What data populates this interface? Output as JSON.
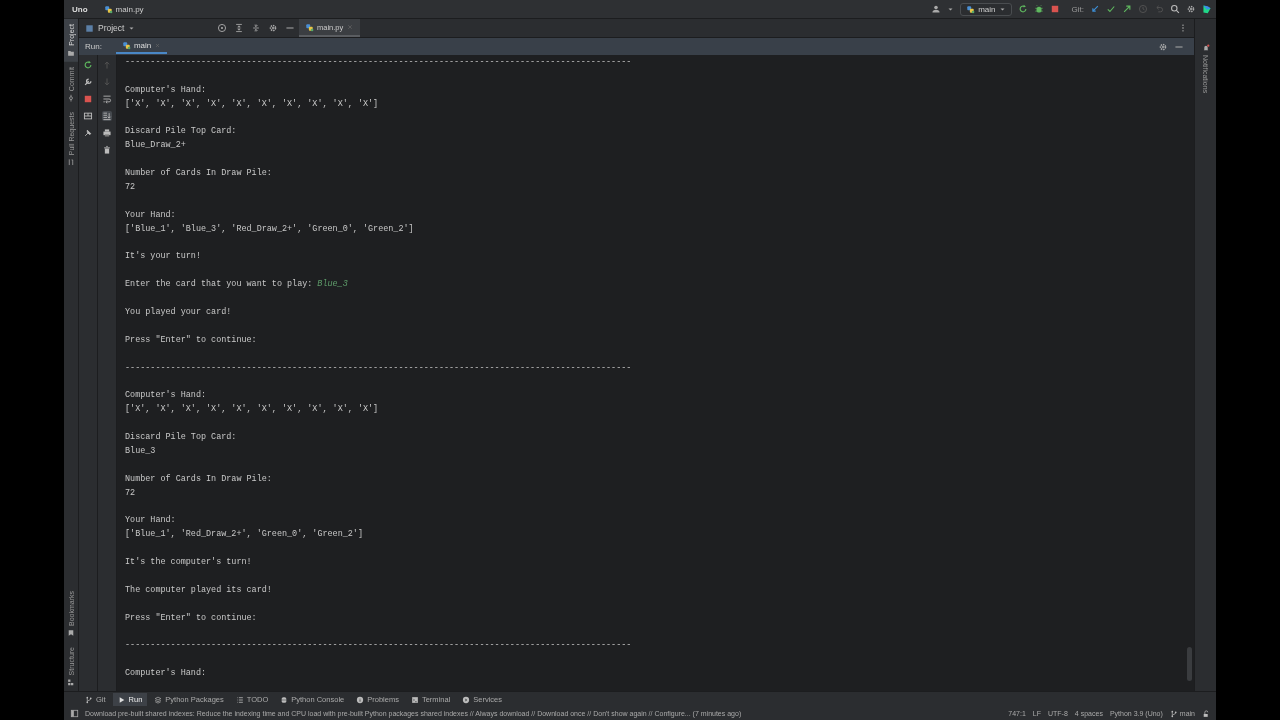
{
  "title_bar": {
    "project": "Uno",
    "file": "main.py",
    "branch": "main",
    "git_label": "Git:"
  },
  "left_stripe_top": [
    {
      "label": "Project",
      "selected": true
    },
    {
      "label": "Commit",
      "selected": false
    },
    {
      "label": "Pull Requests",
      "selected": false
    }
  ],
  "left_stripe_bottom": [
    {
      "label": "Bookmarks",
      "selected": false
    },
    {
      "label": "Structure",
      "selected": false
    }
  ],
  "project_header": {
    "label": "Project"
  },
  "editor_tabs": [
    {
      "label": "main.py",
      "selected": true
    }
  ],
  "run_panel": {
    "label": "Run:",
    "tabs": [
      {
        "label": "main",
        "selected": true
      }
    ],
    "console": [
      {
        "kind": "text",
        "text": "----------------------------------------------------------------------------------------------------"
      },
      {
        "kind": "blank"
      },
      {
        "kind": "text",
        "text": "Computer's Hand:"
      },
      {
        "kind": "text",
        "text": "['X', 'X', 'X', 'X', 'X', 'X', 'X', 'X', 'X', 'X']"
      },
      {
        "kind": "blank"
      },
      {
        "kind": "text",
        "text": "Discard Pile Top Card:"
      },
      {
        "kind": "text",
        "text": "Blue_Draw_2+"
      },
      {
        "kind": "blank"
      },
      {
        "kind": "text",
        "text": "Number of Cards In Draw Pile:"
      },
      {
        "kind": "text",
        "text": "72"
      },
      {
        "kind": "blank"
      },
      {
        "kind": "text",
        "text": "Your Hand:"
      },
      {
        "kind": "text",
        "text": "['Blue_1', 'Blue_3', 'Red_Draw_2+', 'Green_0', 'Green_2']"
      },
      {
        "kind": "blank"
      },
      {
        "kind": "text",
        "text": "It's your turn!"
      },
      {
        "kind": "blank"
      },
      {
        "kind": "prompt",
        "text": "Enter the card that you want to play:",
        "input": "Blue_3"
      },
      {
        "kind": "blank"
      },
      {
        "kind": "text",
        "text": "You played your card!"
      },
      {
        "kind": "blank"
      },
      {
        "kind": "text",
        "text": "Press \"Enter\" to continue:"
      },
      {
        "kind": "blank"
      },
      {
        "kind": "text",
        "text": "----------------------------------------------------------------------------------------------------"
      },
      {
        "kind": "blank"
      },
      {
        "kind": "text",
        "text": "Computer's Hand:"
      },
      {
        "kind": "text",
        "text": "['X', 'X', 'X', 'X', 'X', 'X', 'X', 'X', 'X', 'X']"
      },
      {
        "kind": "blank"
      },
      {
        "kind": "text",
        "text": "Discard Pile Top Card:"
      },
      {
        "kind": "text",
        "text": "Blue_3"
      },
      {
        "kind": "blank"
      },
      {
        "kind": "text",
        "text": "Number of Cards In Draw Pile:"
      },
      {
        "kind": "text",
        "text": "72"
      },
      {
        "kind": "blank"
      },
      {
        "kind": "text",
        "text": "Your Hand:"
      },
      {
        "kind": "text",
        "text": "['Blue_1', 'Red_Draw_2+', 'Green_0', 'Green_2']"
      },
      {
        "kind": "blank"
      },
      {
        "kind": "text",
        "text": "It's the computer's turn!"
      },
      {
        "kind": "blank"
      },
      {
        "kind": "text",
        "text": "The computer played its card!"
      },
      {
        "kind": "blank"
      },
      {
        "kind": "text",
        "text": "Press \"Enter\" to continue:"
      },
      {
        "kind": "blank"
      },
      {
        "kind": "text",
        "text": "----------------------------------------------------------------------------------------------------"
      },
      {
        "kind": "blank"
      },
      {
        "kind": "text",
        "text": "Computer's Hand:"
      }
    ]
  },
  "right_stripe": [
    {
      "label": "Notifications"
    }
  ],
  "tool_tabs": [
    {
      "label": "Git",
      "selected": false
    },
    {
      "label": "Run",
      "selected": true
    },
    {
      "label": "Python Packages",
      "selected": false
    },
    {
      "label": "TODO",
      "selected": false
    },
    {
      "label": "Python Console",
      "selected": false
    },
    {
      "label": "Problems",
      "selected": false
    },
    {
      "label": "Terminal",
      "selected": false
    },
    {
      "label": "Services",
      "selected": false
    }
  ],
  "status_bar": {
    "message": "Download pre-built shared indexes: Reduce the indexing time and CPU load with pre-built Python packages shared indexes // Always download // Download once // Don't show again // Configure... (7 minutes ago)",
    "items": [
      "747:1",
      "LF",
      "UTF-8",
      "4 spaces",
      "Python 3.9 (Uno)"
    ],
    "branch": "main"
  }
}
